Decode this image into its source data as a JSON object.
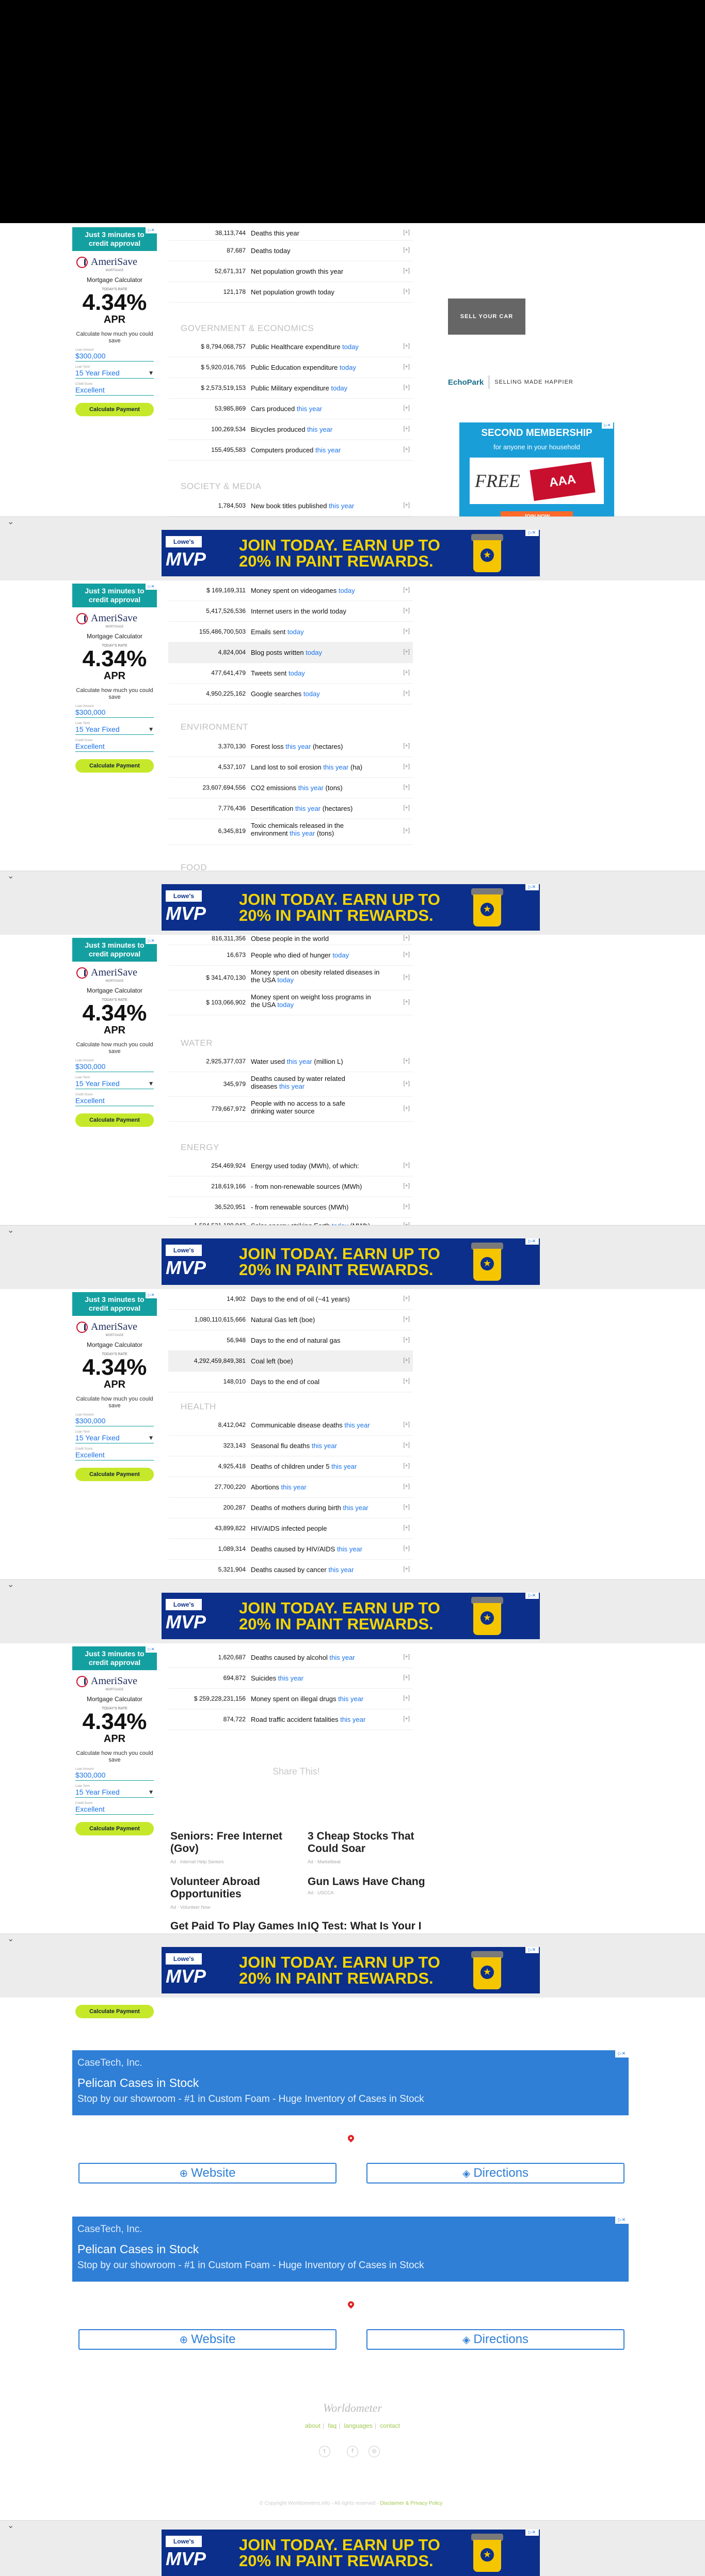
{
  "banner_ad": {
    "brand": "Lowe's",
    "program": "MVP",
    "headline_1": "JOIN TODAY. EARN UP TO",
    "headline_2": "20% IN PAINT REWARDS."
  },
  "mortgage_ad": {
    "headline": "Just 3 minutes to credit approval",
    "logo": "AmeriSave",
    "logo_sub": "MORTGAGE",
    "calculator_title": "Mortgage Calculator",
    "rate_label": "TODAY'S RATE",
    "rate": "4.34%",
    "apr": "APR",
    "description": "Calculate how much you could save",
    "loan_amount_label": "Loan Amount",
    "loan_amount": "$300,000",
    "loan_term_label": "Loan Term",
    "loan_term": "15 Year Fixed",
    "credit_score_label": "Credit Score",
    "credit_score": "Excellent",
    "cta": "Calculate Payment"
  },
  "sections": {
    "gov": "GOVERNMENT & ECONOMICS",
    "society": "SOCIETY & MEDIA",
    "environment": "ENVIRONMENT",
    "food": "FOOD",
    "water": "WATER",
    "energy": "ENERGY",
    "health": "HEALTH"
  },
  "population_rows": [
    {
      "value": "38,113,744",
      "text": "Deaths this year",
      "link": ""
    },
    {
      "value": "87,687",
      "text": "Deaths today",
      "link": ""
    },
    {
      "value": "52,671,317",
      "text": "Net population growth this year",
      "link": ""
    },
    {
      "value": "121,178",
      "text": "Net population growth today",
      "link": ""
    }
  ],
  "gov_rows": [
    {
      "value": "$ 8,794,068,757",
      "text": "Public Healthcare expenditure",
      "link": "today"
    },
    {
      "value": "$ 5,920,016,765",
      "text": "Public Education expenditure",
      "link": "today"
    },
    {
      "value": "$ 2,573,519,153",
      "text": "Public Military expenditure",
      "link": "today"
    },
    {
      "value": "53,985,869",
      "text": "Cars produced",
      "link": "this year"
    },
    {
      "value": "100,269,534",
      "text": "Bicycles produced",
      "link": "this year"
    },
    {
      "value": "155,495,583",
      "text": "Computers produced",
      "link": "this year"
    }
  ],
  "society_rows": [
    {
      "value": "1,784,503",
      "text": "New book titles published",
      "link": "this year"
    },
    {
      "value": "$ 169,169,311",
      "text": "Money spent on videogames",
      "link": "today"
    },
    {
      "value": "5,417,526,536",
      "text": "Internet users in the world today",
      "link": ""
    },
    {
      "value": "155,486,700,503",
      "text": "Emails sent",
      "link": "today"
    },
    {
      "value": "4,824,004",
      "text": "Blog posts written",
      "link": "today"
    },
    {
      "value": "477,641,479",
      "text": "Tweets sent",
      "link": "today"
    },
    {
      "value": "4,950,225,162",
      "text": "Google searches",
      "link": "today"
    }
  ],
  "environment_rows": [
    {
      "value": "3,370,130",
      "text": "Forest loss",
      "link": "this year",
      "suffix": " (hectares)"
    },
    {
      "value": "4,537,107",
      "text": "Land lost to soil erosion",
      "link": "this year",
      "suffix": " (ha)"
    },
    {
      "value": "23,607,694,556",
      "text": "CO2 emissions",
      "link": "this year",
      "suffix": " (tons)"
    },
    {
      "value": "7,776,436",
      "text": "Desertification",
      "link": "this year",
      "suffix": " (hectares)"
    },
    {
      "value": "6,345,819",
      "text": "Toxic chemicals released in the environment",
      "link": "this year",
      "suffix": " (tons)"
    }
  ],
  "food_rows": [
    {
      "value": "816,311,356",
      "text": "Obese people in the world",
      "link": ""
    },
    {
      "value": "16,673",
      "text": "People who died of hunger",
      "link": "today"
    },
    {
      "value": "$ 341,470,130",
      "text": "Money spent on obesity related diseases in the USA",
      "link": "today"
    },
    {
      "value": "$ 103,066,902",
      "text": "Money spent on weight loss programs in the USA",
      "link": "today"
    }
  ],
  "water_rows": [
    {
      "value": "2,925,377,037",
      "text": "Water used",
      "link": "this year",
      "suffix": " (million L)"
    },
    {
      "value": "345,979",
      "text": "Deaths caused by water related diseases",
      "link": "this year"
    },
    {
      "value": "779,667,972",
      "text": "People with no access to a safe drinking water source",
      "link": ""
    }
  ],
  "energy_rows": [
    {
      "value": "254,469,924",
      "text": "Energy used today (MWh), of which:",
      "link": ""
    },
    {
      "value": "218,619,166",
      "text": "- from non-renewable sources (MWh)",
      "link": ""
    },
    {
      "value": "36,520,951",
      "text": "- from renewable sources (MWh)",
      "link": ""
    },
    {
      "value": "1,594,521,189,943",
      "text": "Solar energy striking Earth",
      "link": "today",
      "suffix": " (MWh)"
    },
    {
      "value": "14,902",
      "text": "Days to the end of oil (~41 years)",
      "link": ""
    },
    {
      "value": "1,080,110,615,666",
      "text": "Natural Gas left (boe)",
      "link": ""
    },
    {
      "value": "56,948",
      "text": "Days to the end of natural gas",
      "link": ""
    },
    {
      "value": "4,292,459,849,381",
      "text": "Coal left (boe)",
      "link": ""
    },
    {
      "value": "148,010",
      "text": "Days to the end of coal",
      "link": ""
    }
  ],
  "health_rows": [
    {
      "value": "8,412,042",
      "text": "Communicable disease deaths",
      "link": "this year"
    },
    {
      "value": "323,143",
      "text": "Seasonal flu deaths",
      "link": "this year"
    },
    {
      "value": "4,925,418",
      "text": "Deaths of children under 5",
      "link": "this year"
    },
    {
      "value": "27,700,220",
      "text": "Abortions",
      "link": "this year"
    },
    {
      "value": "200,287",
      "text": "Deaths of mothers during birth",
      "link": "this year"
    },
    {
      "value": "43,899,822",
      "text": "HIV/AIDS infected people",
      "link": ""
    },
    {
      "value": "1,089,314",
      "text": "Deaths caused by HIV/AIDS",
      "link": "this year"
    },
    {
      "value": "5,321,904",
      "text": "Deaths caused by cancer",
      "link": "this year"
    },
    {
      "value": "1,620,687",
      "text": "Deaths caused by alcohol",
      "link": "this year"
    },
    {
      "value": "694,872",
      "text": "Suicides",
      "link": "this year"
    },
    {
      "value": "$ 259,228,231,156",
      "text": "Money spent on illegal drugs",
      "link": "this year"
    },
    {
      "value": "874,722",
      "text": "Road traffic accident fatalities",
      "link": "this year"
    }
  ],
  "right_ads": {
    "car_ad": "SELL YOUR CAR",
    "echopark": "EchoPark",
    "echopark_tagline": "SELLING MADE HAPPIER",
    "membership_title": "SECOND MEMBERSHIP",
    "membership_sub": "for anyone in your household",
    "membership_free": "FREE",
    "membership_card": "AAA",
    "membership_cta": "JOIN NOW"
  },
  "share_label": "Share This!",
  "native_ads": [
    {
      "title": "Seniors: Free Internet (Gov)",
      "source": "Ad · Internet Help Seniors"
    },
    {
      "title": "3 Cheap Stocks That Could Soar",
      "source": "Ad · Marketbeat"
    },
    {
      "title": "Volunteer Abroad Opportunities",
      "source": "Ad · Volunteer Now"
    },
    {
      "title": "Gun Laws Have Chang",
      "source": "Ad · USCCA"
    },
    {
      "title": "Get Paid To Play Games In Apps",
      "source": ""
    },
    {
      "title": "IQ Test: What Is Your I",
      "source": ""
    }
  ],
  "casetech_ads": [
    {
      "company": "CaseTech, Inc.",
      "title": "Pelican Cases in Stock",
      "desc": "Stop by our showroom - #1 in Custom Foam - Huge Inventory of Cases in Stock",
      "website": "Website",
      "directions": "Directions"
    },
    {
      "company": "CaseTech, Inc.",
      "title": "Pelican Cases in Stock",
      "desc": "Stop by our showroom - #1 in Custom Foam - Huge Inventory of Cases in Stock",
      "website": "Website",
      "directions": "Directions"
    }
  ],
  "footer": {
    "logo": "Worldometer",
    "about": "about",
    "faq": "faq",
    "languages": "languages",
    "contact": "contact",
    "copyright": "© Copyright Worldometers.info - All rights reserved -",
    "disclaimer": "Disclaimer & Privacy Policy"
  }
}
